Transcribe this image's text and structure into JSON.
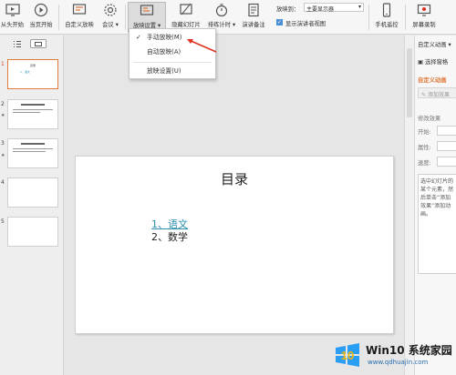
{
  "ribbon": {
    "buttons": [
      {
        "id": "from-start",
        "label": "从头开始"
      },
      {
        "id": "from-current",
        "label": "当页开始"
      },
      {
        "id": "custom-show",
        "label": "自定义放映"
      },
      {
        "id": "meeting",
        "label": "会议 ▾"
      },
      {
        "id": "show-settings",
        "label": "放映设置 ▾"
      },
      {
        "id": "hide-slide",
        "label": "隐藏幻灯片"
      },
      {
        "id": "rehearse",
        "label": "排练计时 ▾"
      },
      {
        "id": "speaker-notes",
        "label": "演讲备注"
      },
      {
        "id": "phone-remote",
        "label": "手机遥控"
      },
      {
        "id": "screen-record",
        "label": "屏幕录制"
      }
    ],
    "show_to_label": "放映到：",
    "show_to_value": "主要显示器",
    "presenter_view_label": "显示演讲者视图"
  },
  "dropdown": {
    "items": [
      {
        "label": "手动放映(M)",
        "checked": "✓"
      },
      {
        "label": "自动放映(A)"
      },
      {
        "label": "放映设置(U)"
      }
    ]
  },
  "slides_panel": {
    "slides": [
      {
        "num": "1",
        "title": "目录",
        "line": "1、语文"
      },
      {
        "num": "2",
        "star": "★"
      },
      {
        "num": "3",
        "star": "★"
      },
      {
        "num": "4"
      },
      {
        "num": "5"
      }
    ]
  },
  "slide": {
    "title": "目录",
    "items": [
      "1、语文",
      "2、数学"
    ]
  },
  "right_panel": {
    "header": "自定义动画 ▾",
    "select_pane": "选择窗格",
    "custom_anim": "自定义动画",
    "add_effect": "添加效果",
    "modify_effect": "修改效果",
    "start_label": "开始:",
    "property_label": "属性:",
    "speed_label": "速度:",
    "hint": "选中幻灯片的某个元素，然后单击“添加效果”添加动画。"
  },
  "watermark": {
    "logo": "10",
    "brand": "Win10 系统家园",
    "url": "www.qdhuajin.com"
  },
  "colors": {
    "accent_orange": "#e07a3a",
    "link_teal": "#2b8fb0",
    "arrow_red": "#e03020"
  }
}
